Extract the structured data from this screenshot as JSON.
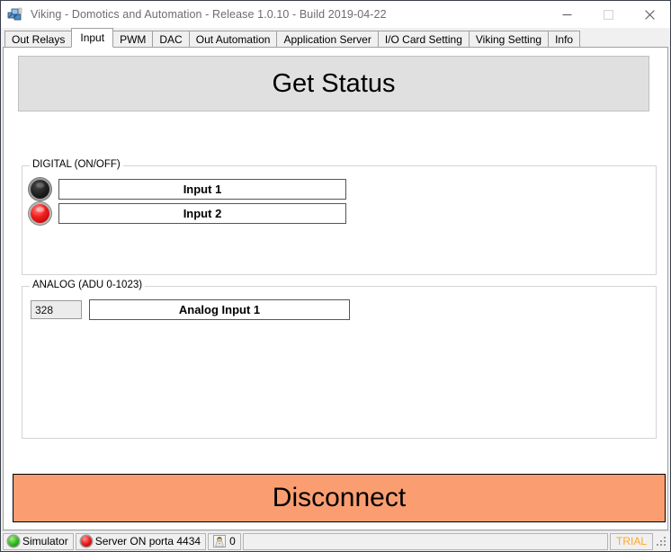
{
  "window": {
    "title": "Viking - Domotics and Automation - Release 1.0.10 - Build 2019-04-22",
    "icon": "app-icon",
    "minimize_label": "–",
    "maximize_label": "□",
    "close_label": "✕"
  },
  "tabs": [
    {
      "label": "Out Relays",
      "active": false
    },
    {
      "label": "Input",
      "active": true
    },
    {
      "label": "PWM",
      "active": false
    },
    {
      "label": "DAC",
      "active": false
    },
    {
      "label": "Out Automation",
      "active": false
    },
    {
      "label": "Application Server",
      "active": false
    },
    {
      "label": "I/O Card Setting",
      "active": false
    },
    {
      "label": "Viking Setting",
      "active": false
    },
    {
      "label": "Info",
      "active": false
    }
  ],
  "main": {
    "get_status_label": "Get Status",
    "digital": {
      "title": "DIGITAL (ON/OFF)",
      "rows": [
        {
          "label": "Input 1",
          "state": "off",
          "led_color": "#1d1d1d"
        },
        {
          "label": "Input 2",
          "state": "on",
          "led_color": "#f01c1c"
        }
      ]
    },
    "analog": {
      "title": "ANALOG (ADU 0-1023)",
      "rows": [
        {
          "value": "328",
          "label": "Analog Input 1"
        }
      ]
    },
    "disconnect_label": "Disconnect",
    "disconnect_color": "#fa9e72"
  },
  "statusbar": {
    "simulator": {
      "label": "Simulator",
      "led": "green",
      "led_color": "#2fbf1f"
    },
    "server": {
      "label": "Server ON porta 4434",
      "led": "red",
      "led_color": "#ec1c1c"
    },
    "users": {
      "label": "0",
      "icon": "user-icon"
    },
    "trial": {
      "label": "TRIAL",
      "color": "#ffa726"
    }
  }
}
